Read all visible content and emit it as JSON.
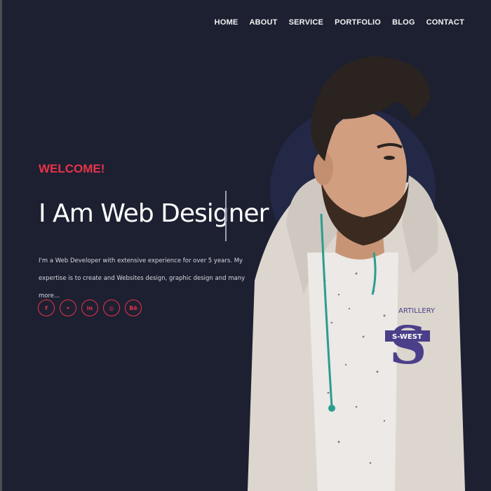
{
  "nav": {
    "items": [
      {
        "label": "HOME"
      },
      {
        "label": "ABOUT"
      },
      {
        "label": "SERVICE"
      },
      {
        "label": "PORTFOLIO"
      },
      {
        "label": "BLOG"
      },
      {
        "label": "CONTACT"
      }
    ]
  },
  "hero": {
    "welcome": "WELCOME!",
    "headline": "I Am Web Designer",
    "description": "I'm a Web Developer with extensive experience for over 5 years. My expertise is to create and Websites design, graphic design and many more...",
    "socials": [
      {
        "icon": "facebook-icon",
        "glyph": "f"
      },
      {
        "icon": "twitter-icon",
        "glyph": "•"
      },
      {
        "icon": "linkedin-icon",
        "glyph": "in"
      },
      {
        "icon": "instagram-icon",
        "glyph": "◎"
      },
      {
        "icon": "behance-icon",
        "glyph": "Bē"
      }
    ],
    "hoodie_text": {
      "top": "ARTILLERY",
      "letter": "S",
      "band": "S-WEST"
    }
  },
  "colors": {
    "background": "#1d2031",
    "accent": "#e8334a",
    "circle": "#222845"
  }
}
